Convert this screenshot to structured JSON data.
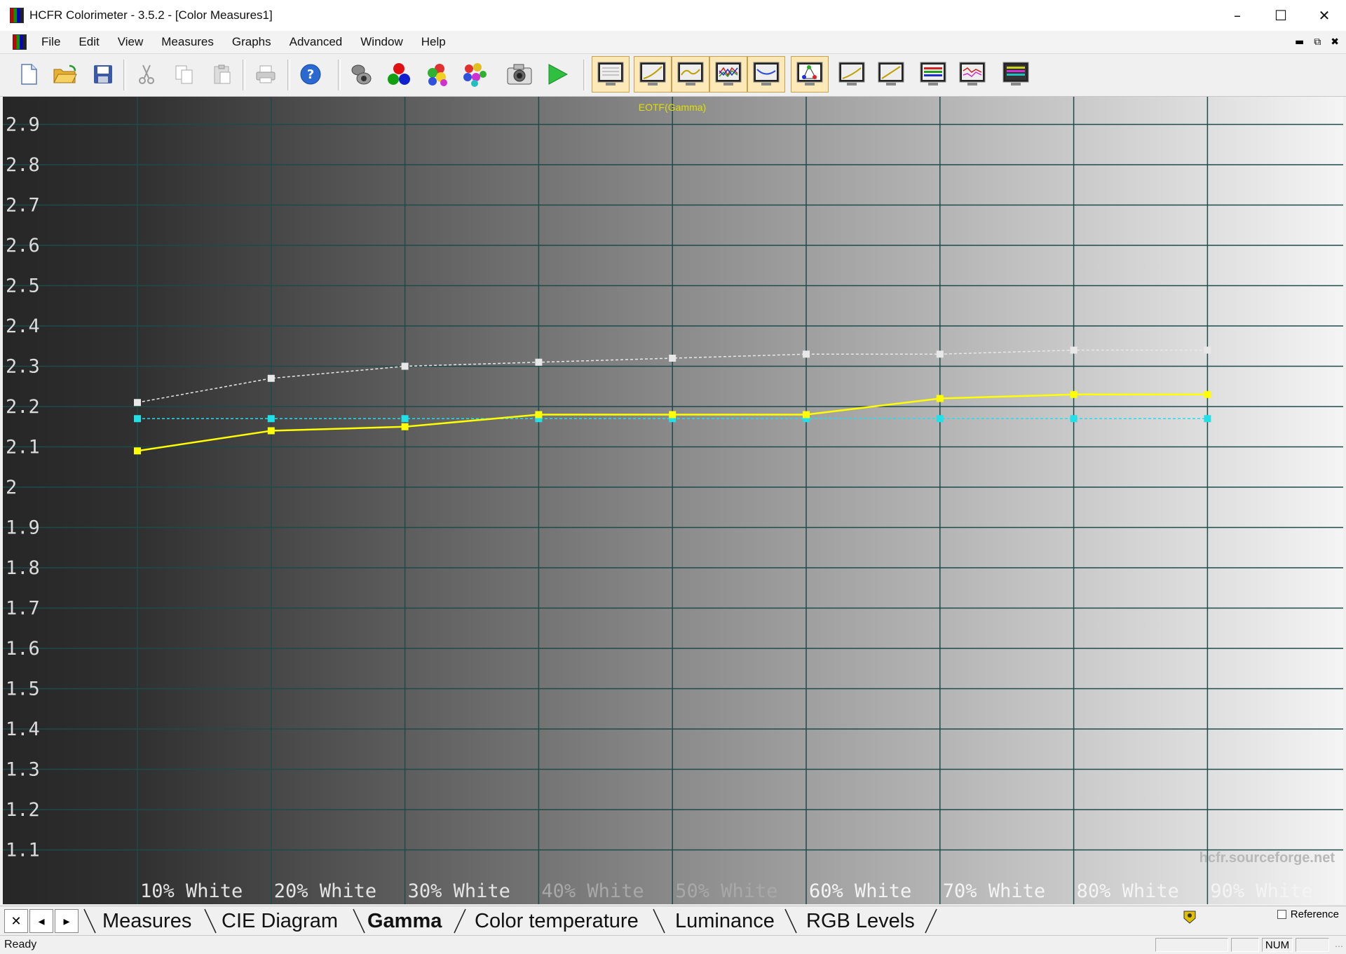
{
  "window": {
    "title": "HCFR Colorimeter - 3.5.2 - [Color Measures1]",
    "minimize_icon": "minimize-icon",
    "maximize_icon": "maximize-icon",
    "close_icon": "close-icon"
  },
  "menu": [
    "File",
    "Edit",
    "View",
    "Measures",
    "Graphs",
    "Advanced",
    "Window",
    "Help"
  ],
  "toolbar": {
    "buttons": [
      "new-icon",
      "open-icon",
      "save-icon",
      "cut-icon",
      "copy-icon",
      "paste-icon",
      "print-icon",
      "help-icon",
      "sensor-icon",
      "rgb-measure-icon",
      "color-measure-icon",
      "multi-measure-icon",
      "camera-icon",
      "play-icon",
      "gray-scale-view-icon",
      "gamma-view-icon",
      "luminance-view-icon",
      "rgb-levels-view-icon",
      "color-temp-view-icon",
      "cie-view-icon",
      "view-icon-1",
      "view-icon-2",
      "view-icon-3",
      "view-icon-4",
      "view-icon-5"
    ]
  },
  "chart_data": {
    "type": "line",
    "title": "EOTF(Gamma)",
    "categories": [
      "10% White",
      "20% White",
      "30% White",
      "40% White",
      "50% White",
      "60% White",
      "70% White",
      "80% White",
      "90% White"
    ],
    "ylim": [
      1.0,
      3.0
    ],
    "yticks": [
      "2.9",
      "2.8",
      "2.7",
      "2.6",
      "2.5",
      "2.4",
      "2.3",
      "2.2",
      "2.1",
      "2",
      "1.9",
      "1.8",
      "1.7",
      "1.6",
      "1.5",
      "1.4",
      "1.3",
      "1.2",
      "1.1"
    ],
    "grid": true,
    "watermark": "hcfr.sourceforge.net",
    "series": [
      {
        "color": "#ffff00",
        "style": "solid",
        "values": [
          2.09,
          2.14,
          2.15,
          2.18,
          2.18,
          2.18,
          2.22,
          2.23,
          2.23
        ]
      },
      {
        "color": "#22e0e8",
        "style": "dashed",
        "values": [
          2.17,
          2.17,
          2.17,
          2.17,
          2.17,
          2.17,
          2.17,
          2.17,
          2.17
        ]
      },
      {
        "color": "#e8e8e8",
        "style": "dashed",
        "values": [
          2.21,
          2.27,
          2.3,
          2.31,
          2.32,
          2.33,
          2.33,
          2.34,
          2.34
        ]
      }
    ]
  },
  "tabs": [
    "Measures",
    "CIE Diagram",
    "Gamma",
    "Color temperature",
    "Luminance",
    "RGB Levels"
  ],
  "active_tab": "Gamma",
  "reference_label": "Reference",
  "status": {
    "text": "Ready",
    "num": "NUM"
  }
}
